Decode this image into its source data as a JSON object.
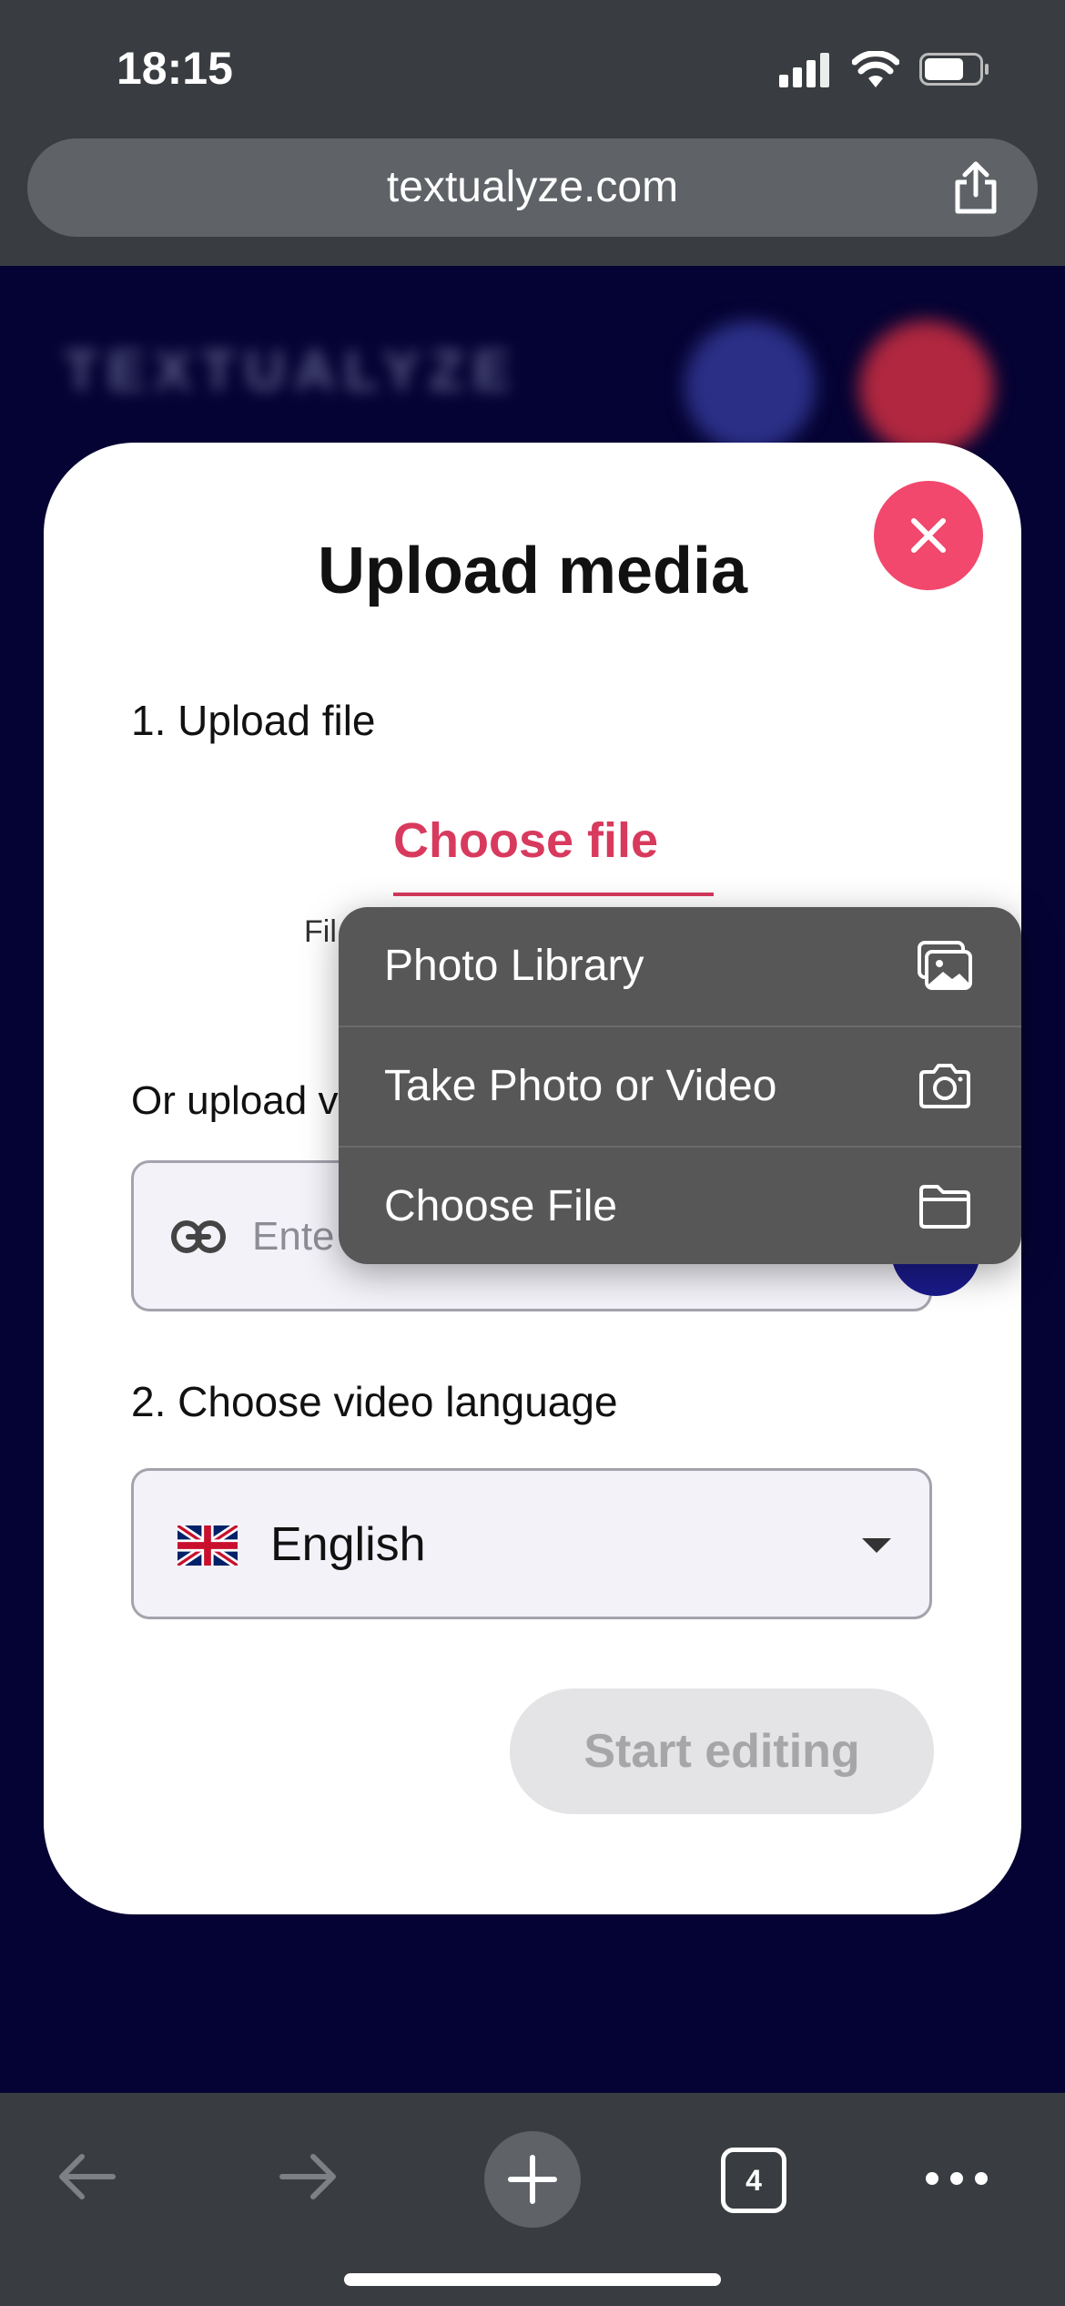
{
  "status_bar": {
    "time": "18:15"
  },
  "browser": {
    "url": "textualyze.com",
    "tab_count": "4"
  },
  "background": {
    "logo_text": "TEXTUALYZE"
  },
  "modal": {
    "title": "Upload media",
    "step1_label": "1. Upload file",
    "choose_file_label": "Choose file",
    "file_hint": "Fil",
    "url_label": "Or upload v",
    "url_placeholder": "Ente",
    "step2_label": "2. Choose video language",
    "language": "English",
    "start_label": "Start editing"
  },
  "menu": {
    "items": [
      {
        "label": "Photo Library",
        "icon": "photo-library-icon"
      },
      {
        "label": "Take Photo or Video",
        "icon": "camera-icon"
      },
      {
        "label": "Choose File",
        "icon": "folder-icon"
      }
    ]
  },
  "colors": {
    "accent": "#d83a5e",
    "close": "#f2486d",
    "menu_bg": "#575758",
    "page_bg": "#050333"
  }
}
